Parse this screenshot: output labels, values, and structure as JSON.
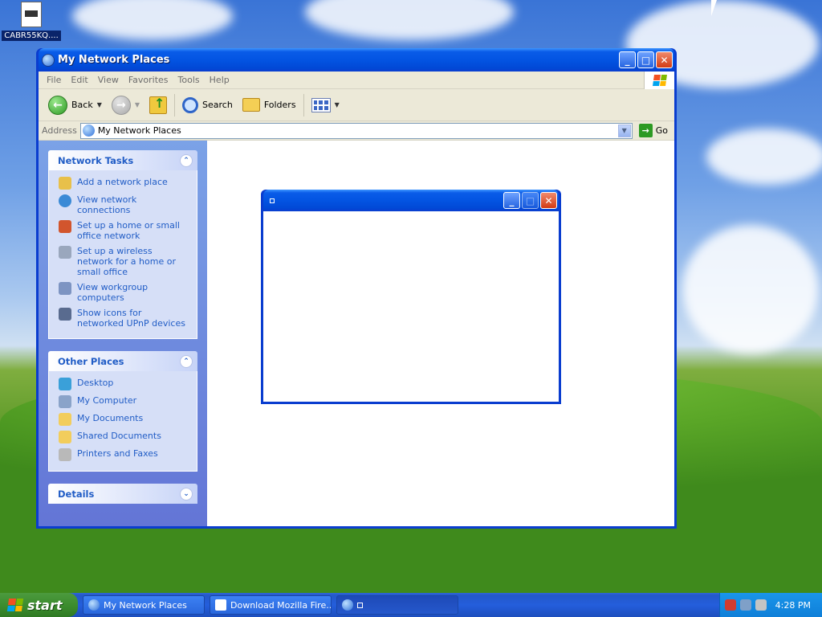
{
  "desktop": {
    "icon_label": "CABR55KQ...."
  },
  "window": {
    "title": "My Network Places",
    "menu": [
      "File",
      "Edit",
      "View",
      "Favorites",
      "Tools",
      "Help"
    ],
    "toolbar": {
      "back_label": "Back",
      "search_label": "Search",
      "folders_label": "Folders"
    },
    "address": {
      "label": "Address",
      "value": "My Network Places",
      "go_label": "Go"
    },
    "network_tasks": {
      "title": "Network Tasks",
      "items": [
        "Add a network place",
        "View network connections",
        "Set up a home or small office network",
        "Set up a wireless network for a home or small office",
        "View workgroup computers",
        "Show icons for networked UPnP devices"
      ]
    },
    "other_places": {
      "title": "Other Places",
      "items": [
        "Desktop",
        "My Computer",
        "My Documents",
        "Shared Documents",
        "Printers and Faxes"
      ]
    },
    "details": {
      "title": "Details"
    }
  },
  "taskbar": {
    "start_label": "start",
    "tasks": [
      "My Network Places",
      "Download Mozilla Fire...",
      ""
    ],
    "clock": "4:28 PM"
  },
  "colors": {
    "title_blue": "#0354e2",
    "link_blue": "#215dc6",
    "start_green": "#3a8a2c",
    "tray_blue": "#0f7fd8"
  }
}
